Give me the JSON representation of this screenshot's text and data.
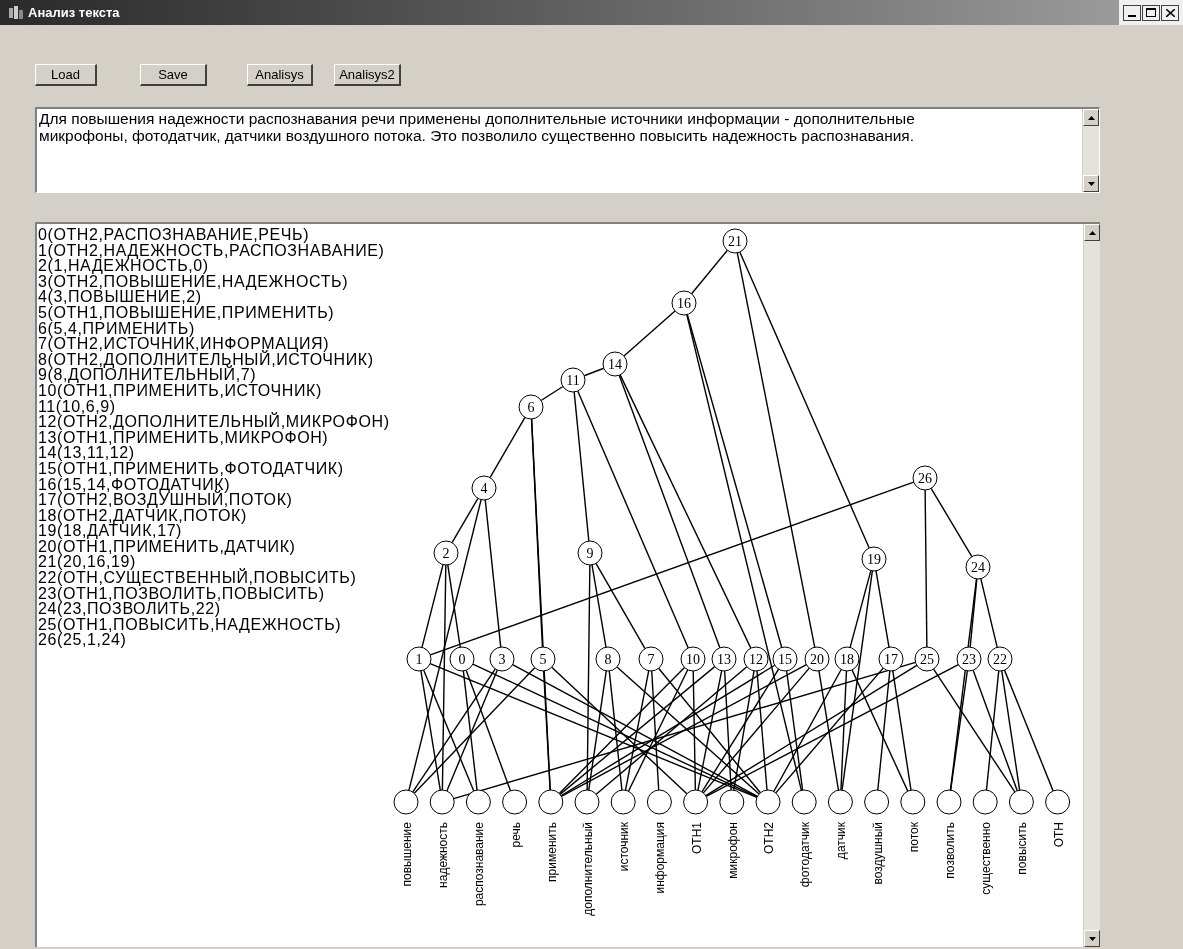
{
  "window": {
    "title": "Анализ текста"
  },
  "buttons": [
    "Load",
    "Save",
    "Analisys",
    "Analisys2"
  ],
  "text_area": {
    "value": "Для повышения надежности распознавания речи применены  дополнительные источники информации - дополнительные микрофоны, фотодатчик, датчики воздушного потока. Это позволило существенно повысить надежность распознавания."
  },
  "relations": [
    "0(ОТН2,РАСПОЗНАВАНИЕ,РЕЧЬ)",
    "1(ОТН2,НАДЕЖНОСТЬ,РАСПОЗНАВАНИЕ)",
    "2(1,НАДЕЖНОСТЬ,0)",
    "3(ОТН2,ПОВЫШЕНИЕ,НАДЕЖНОСТЬ)",
    "4(3,ПОВЫШЕНИЕ,2)",
    "5(ОТН1,ПОВЫШЕНИЕ,ПРИМЕНИТЬ)",
    "6(5,4,ПРИМЕНИТЬ)",
    "7(ОТН2,ИСТОЧНИК,ИНФОРМАЦИЯ)",
    "8(ОТН2,ДОПОЛНИТЕЛЬНЫЙ,ИСТОЧНИК)",
    "9(8,ДОПОЛНИТЕЛЬНЫЙ,7)",
    "10(ОТН1,ПРИМЕНИТЬ,ИСТОЧНИК)",
    "11(10,6,9)",
    "12(ОТН2,ДОПОЛНИТЕЛЬНЫЙ,МИКРОФОН)",
    "13(ОТН1,ПРИМЕНИТЬ,МИКРОФОН)",
    "14(13,11,12)",
    "15(ОТН1,ПРИМЕНИТЬ,ФОТОДАТЧИК)",
    "16(15,14,ФОТОДАТЧИК)",
    "17(ОТН2,ВОЗДУШНЫЙ,ПОТОК)",
    "18(ОТН2,ДАТЧИК,ПОТОК)",
    "19(18,ДАТЧИК,17)",
    "20(ОТН1,ПРИМЕНИТЬ,ДАТЧИК)",
    "21(20,16,19)",
    "22(ОТН,СУЩЕСТВЕННЫЙ,ПОВЫСИТЬ)",
    "23(ОТН1,ПОЗВОЛИТЬ,ПОВЫСИТЬ)",
    "24(23,ПОЗВОЛИТЬ,22)",
    "25(ОТН1,ПОВЫСИТЬ,НАДЕЖНОСТЬ)",
    "26(25,1,24)"
  ],
  "graph": {
    "nodes": [
      "21",
      "16",
      "14",
      "11",
      "6",
      "26",
      "4",
      "2",
      "9",
      "19",
      "24",
      "1",
      "0",
      "3",
      "5",
      "8",
      "7",
      "10",
      "13",
      "12",
      "15",
      "20",
      "18",
      "17",
      "25",
      "23",
      "22"
    ],
    "leaves": [
      "повышение",
      "надежность",
      "распознавание",
      "речь",
      "применить",
      "дополнительный",
      "источник",
      "информация",
      "ОТН1",
      "микрофон",
      "ОТН2",
      "фотодатчик",
      "датчик",
      "воздушный",
      "поток",
      "позволить",
      "существенно",
      "повысить",
      "ОТН"
    ]
  }
}
